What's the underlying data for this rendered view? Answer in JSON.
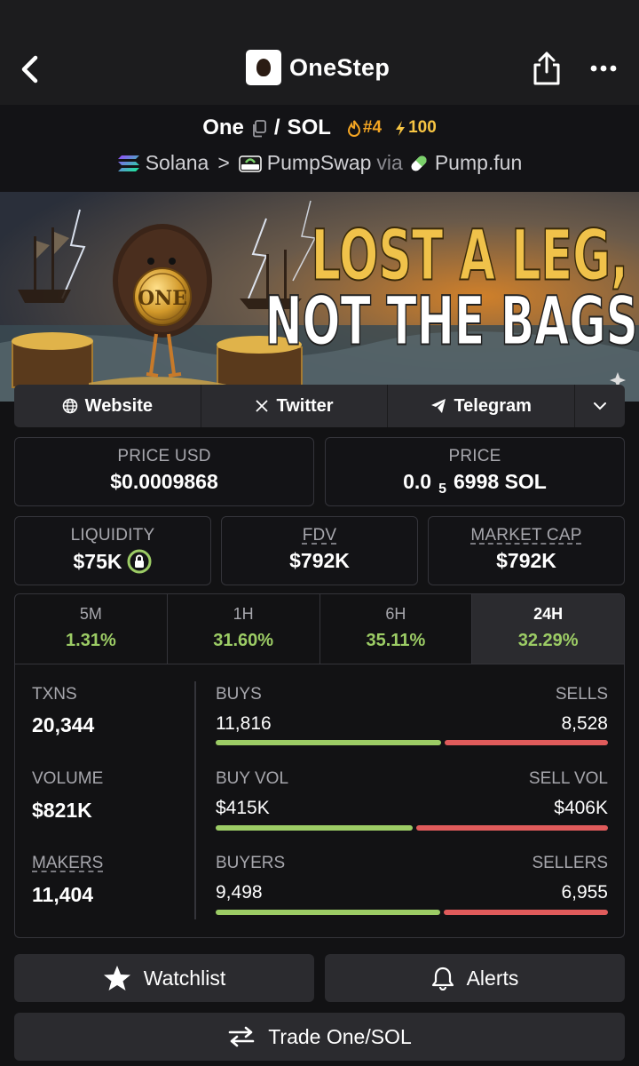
{
  "app": {
    "title": "OneStep"
  },
  "pair": {
    "base": "One",
    "quote": "SOL",
    "separator": "/",
    "rank": "#4",
    "boosts": "100"
  },
  "chain": {
    "network": "Solana",
    "dex": "PumpSwap",
    "via_label": "via",
    "launchpad": "Pump.fun",
    "sep": ">"
  },
  "banner": {
    "headline_1": "LOST A LEG,",
    "headline_2": "NOT THE BAGS!",
    "coin_text": "ONE"
  },
  "links": {
    "website": "Website",
    "twitter": "Twitter",
    "telegram": "Telegram"
  },
  "price": {
    "usd_label": "PRICE USD",
    "usd_value": "$0.0009868",
    "native_label": "PRICE",
    "native_prefix": "0.0",
    "native_zeros": "5",
    "native_digits": "6998 SOL"
  },
  "metrics": {
    "liquidity_label": "LIQUIDITY",
    "liquidity_value": "$75K",
    "fdv_label": "FDV",
    "fdv_value": "$792K",
    "mcap_label": "MARKET CAP",
    "mcap_value": "$792K"
  },
  "timeframes": [
    {
      "label": "5M",
      "change": "1.31%"
    },
    {
      "label": "1H",
      "change": "31.60%"
    },
    {
      "label": "6H",
      "change": "35.11%"
    },
    {
      "label": "24H",
      "change": "32.29%",
      "active": true
    }
  ],
  "stats": {
    "txns_label": "TXNS",
    "txns_value": "20,344",
    "volume_label": "VOLUME",
    "volume_value": "$821K",
    "makers_label": "MAKERS",
    "makers_value": "11,404",
    "buys_label": "BUYS",
    "buys_value": "11,816",
    "sells_label": "SELLS",
    "sells_value": "8,528",
    "buy_vol_label": "BUY VOL",
    "buy_vol_value": "$415K",
    "sell_vol_label": "SELL VOL",
    "sell_vol_value": "$406K",
    "buyers_label": "BUYERS",
    "buyers_value": "9,498",
    "sellers_label": "SELLERS",
    "sellers_value": "6,955",
    "buys_ratio": 0.58,
    "buy_vol_ratio": 0.506,
    "buyers_ratio": 0.577
  },
  "actions": {
    "watchlist": "Watchlist",
    "alerts": "Alerts",
    "trade": "Trade One/SOL"
  },
  "colors": {
    "green": "#9ccc65",
    "red": "#e05b5b",
    "rank": "#f5a623",
    "boost": "#f7c543"
  }
}
